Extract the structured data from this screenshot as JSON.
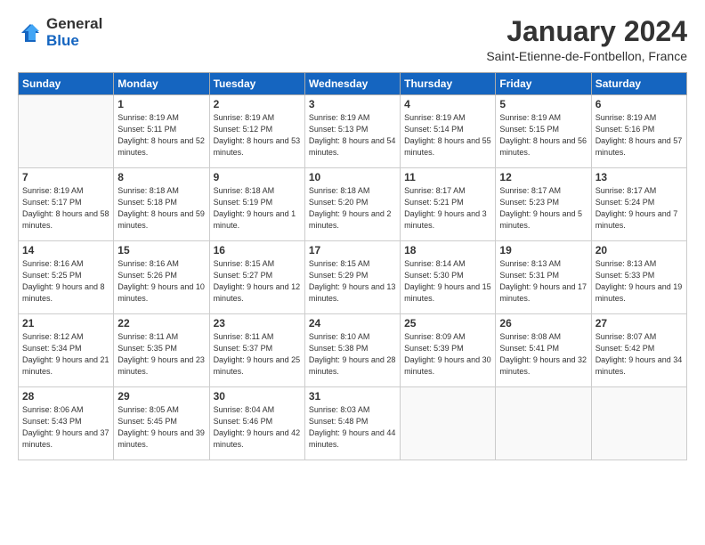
{
  "header": {
    "logo": {
      "general": "General",
      "blue": "Blue"
    },
    "title": "January 2024",
    "location": "Saint-Etienne-de-Fontbellon, France"
  },
  "days_of_week": [
    "Sunday",
    "Monday",
    "Tuesday",
    "Wednesday",
    "Thursday",
    "Friday",
    "Saturday"
  ],
  "weeks": [
    [
      {
        "day": "",
        "sunrise": "",
        "sunset": "",
        "daylight": ""
      },
      {
        "day": "1",
        "sunrise": "Sunrise: 8:19 AM",
        "sunset": "Sunset: 5:11 PM",
        "daylight": "Daylight: 8 hours and 52 minutes."
      },
      {
        "day": "2",
        "sunrise": "Sunrise: 8:19 AM",
        "sunset": "Sunset: 5:12 PM",
        "daylight": "Daylight: 8 hours and 53 minutes."
      },
      {
        "day": "3",
        "sunrise": "Sunrise: 8:19 AM",
        "sunset": "Sunset: 5:13 PM",
        "daylight": "Daylight: 8 hours and 54 minutes."
      },
      {
        "day": "4",
        "sunrise": "Sunrise: 8:19 AM",
        "sunset": "Sunset: 5:14 PM",
        "daylight": "Daylight: 8 hours and 55 minutes."
      },
      {
        "day": "5",
        "sunrise": "Sunrise: 8:19 AM",
        "sunset": "Sunset: 5:15 PM",
        "daylight": "Daylight: 8 hours and 56 minutes."
      },
      {
        "day": "6",
        "sunrise": "Sunrise: 8:19 AM",
        "sunset": "Sunset: 5:16 PM",
        "daylight": "Daylight: 8 hours and 57 minutes."
      }
    ],
    [
      {
        "day": "7",
        "sunrise": "Sunrise: 8:19 AM",
        "sunset": "Sunset: 5:17 PM",
        "daylight": "Daylight: 8 hours and 58 minutes."
      },
      {
        "day": "8",
        "sunrise": "Sunrise: 8:18 AM",
        "sunset": "Sunset: 5:18 PM",
        "daylight": "Daylight: 8 hours and 59 minutes."
      },
      {
        "day": "9",
        "sunrise": "Sunrise: 8:18 AM",
        "sunset": "Sunset: 5:19 PM",
        "daylight": "Daylight: 9 hours and 1 minute."
      },
      {
        "day": "10",
        "sunrise": "Sunrise: 8:18 AM",
        "sunset": "Sunset: 5:20 PM",
        "daylight": "Daylight: 9 hours and 2 minutes."
      },
      {
        "day": "11",
        "sunrise": "Sunrise: 8:17 AM",
        "sunset": "Sunset: 5:21 PM",
        "daylight": "Daylight: 9 hours and 3 minutes."
      },
      {
        "day": "12",
        "sunrise": "Sunrise: 8:17 AM",
        "sunset": "Sunset: 5:23 PM",
        "daylight": "Daylight: 9 hours and 5 minutes."
      },
      {
        "day": "13",
        "sunrise": "Sunrise: 8:17 AM",
        "sunset": "Sunset: 5:24 PM",
        "daylight": "Daylight: 9 hours and 7 minutes."
      }
    ],
    [
      {
        "day": "14",
        "sunrise": "Sunrise: 8:16 AM",
        "sunset": "Sunset: 5:25 PM",
        "daylight": "Daylight: 9 hours and 8 minutes."
      },
      {
        "day": "15",
        "sunrise": "Sunrise: 8:16 AM",
        "sunset": "Sunset: 5:26 PM",
        "daylight": "Daylight: 9 hours and 10 minutes."
      },
      {
        "day": "16",
        "sunrise": "Sunrise: 8:15 AM",
        "sunset": "Sunset: 5:27 PM",
        "daylight": "Daylight: 9 hours and 12 minutes."
      },
      {
        "day": "17",
        "sunrise": "Sunrise: 8:15 AM",
        "sunset": "Sunset: 5:29 PM",
        "daylight": "Daylight: 9 hours and 13 minutes."
      },
      {
        "day": "18",
        "sunrise": "Sunrise: 8:14 AM",
        "sunset": "Sunset: 5:30 PM",
        "daylight": "Daylight: 9 hours and 15 minutes."
      },
      {
        "day": "19",
        "sunrise": "Sunrise: 8:13 AM",
        "sunset": "Sunset: 5:31 PM",
        "daylight": "Daylight: 9 hours and 17 minutes."
      },
      {
        "day": "20",
        "sunrise": "Sunrise: 8:13 AM",
        "sunset": "Sunset: 5:33 PM",
        "daylight": "Daylight: 9 hours and 19 minutes."
      }
    ],
    [
      {
        "day": "21",
        "sunrise": "Sunrise: 8:12 AM",
        "sunset": "Sunset: 5:34 PM",
        "daylight": "Daylight: 9 hours and 21 minutes."
      },
      {
        "day": "22",
        "sunrise": "Sunrise: 8:11 AM",
        "sunset": "Sunset: 5:35 PM",
        "daylight": "Daylight: 9 hours and 23 minutes."
      },
      {
        "day": "23",
        "sunrise": "Sunrise: 8:11 AM",
        "sunset": "Sunset: 5:37 PM",
        "daylight": "Daylight: 9 hours and 25 minutes."
      },
      {
        "day": "24",
        "sunrise": "Sunrise: 8:10 AM",
        "sunset": "Sunset: 5:38 PM",
        "daylight": "Daylight: 9 hours and 28 minutes."
      },
      {
        "day": "25",
        "sunrise": "Sunrise: 8:09 AM",
        "sunset": "Sunset: 5:39 PM",
        "daylight": "Daylight: 9 hours and 30 minutes."
      },
      {
        "day": "26",
        "sunrise": "Sunrise: 8:08 AM",
        "sunset": "Sunset: 5:41 PM",
        "daylight": "Daylight: 9 hours and 32 minutes."
      },
      {
        "day": "27",
        "sunrise": "Sunrise: 8:07 AM",
        "sunset": "Sunset: 5:42 PM",
        "daylight": "Daylight: 9 hours and 34 minutes."
      }
    ],
    [
      {
        "day": "28",
        "sunrise": "Sunrise: 8:06 AM",
        "sunset": "Sunset: 5:43 PM",
        "daylight": "Daylight: 9 hours and 37 minutes."
      },
      {
        "day": "29",
        "sunrise": "Sunrise: 8:05 AM",
        "sunset": "Sunset: 5:45 PM",
        "daylight": "Daylight: 9 hours and 39 minutes."
      },
      {
        "day": "30",
        "sunrise": "Sunrise: 8:04 AM",
        "sunset": "Sunset: 5:46 PM",
        "daylight": "Daylight: 9 hours and 42 minutes."
      },
      {
        "day": "31",
        "sunrise": "Sunrise: 8:03 AM",
        "sunset": "Sunset: 5:48 PM",
        "daylight": "Daylight: 9 hours and 44 minutes."
      },
      {
        "day": "",
        "sunrise": "",
        "sunset": "",
        "daylight": ""
      },
      {
        "day": "",
        "sunrise": "",
        "sunset": "",
        "daylight": ""
      },
      {
        "day": "",
        "sunrise": "",
        "sunset": "",
        "daylight": ""
      }
    ]
  ]
}
